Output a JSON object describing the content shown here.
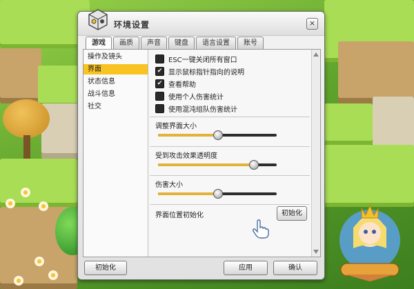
{
  "window": {
    "title": "环境设置",
    "close_glyph": "×"
  },
  "tabs": [
    {
      "label": "游戏",
      "active": true
    },
    {
      "label": "画质",
      "active": false
    },
    {
      "label": "声音",
      "active": false
    },
    {
      "label": "键盘",
      "active": false
    },
    {
      "label": "语言设置",
      "active": false
    },
    {
      "label": "账号",
      "active": false
    }
  ],
  "sidebar": {
    "items": [
      {
        "label": "操作及镜头",
        "selected": false
      },
      {
        "label": "界面",
        "selected": true
      },
      {
        "label": "状态信息",
        "selected": false
      },
      {
        "label": "战斗信息",
        "selected": false
      },
      {
        "label": "社交",
        "selected": false
      }
    ]
  },
  "options": [
    {
      "label": "ESC一键关闭所有窗口",
      "checked": false
    },
    {
      "label": "显示鼠标指针指向的说明",
      "checked": true
    },
    {
      "label": "查看帮助",
      "checked": true
    },
    {
      "label": "使用个人伤害统计",
      "checked": false
    },
    {
      "label": "使用混沌组队伤害统计",
      "checked": false
    }
  ],
  "sliders": [
    {
      "label": "调整界面大小",
      "value": 0.5
    },
    {
      "label": "受到攻击效果透明度",
      "value": 0.8
    },
    {
      "label": "伤害大小",
      "value": 0.5
    }
  ],
  "ui_position": {
    "label": "界面位置初始化",
    "button": "初始化"
  },
  "footer": {
    "reset": "初始化",
    "apply": "应用",
    "confirm": "确认"
  },
  "colors": {
    "selected_item": "#f9c322",
    "slider_fill": "#e2b23a",
    "slider_track": "#2c2c2c"
  }
}
